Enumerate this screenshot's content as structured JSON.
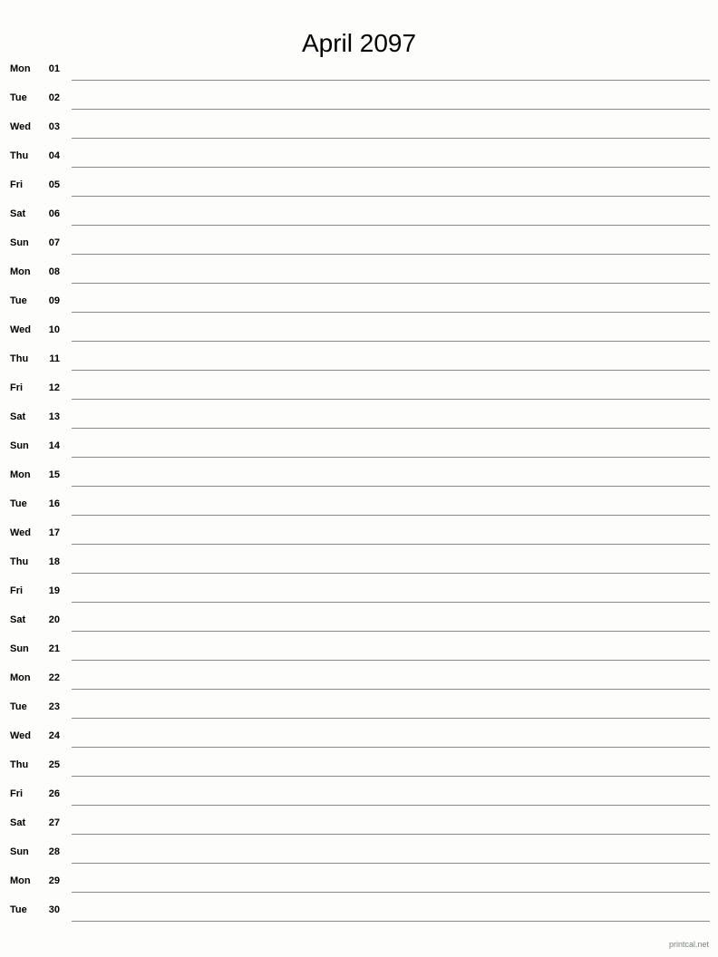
{
  "document": {
    "title": "April 2097",
    "type": "monthly-notes-calendar",
    "month": "April",
    "year": "2097"
  },
  "footer": {
    "credit": "printcal.net"
  },
  "colors": {
    "background": "#fdfefb",
    "text": "#000000",
    "rule_line": "#848a82",
    "footer_text": "#7d827c"
  },
  "days": [
    {
      "abbr": "Mon",
      "num": "01"
    },
    {
      "abbr": "Tue",
      "num": "02"
    },
    {
      "abbr": "Wed",
      "num": "03"
    },
    {
      "abbr": "Thu",
      "num": "04"
    },
    {
      "abbr": "Fri",
      "num": "05"
    },
    {
      "abbr": "Sat",
      "num": "06"
    },
    {
      "abbr": "Sun",
      "num": "07"
    },
    {
      "abbr": "Mon",
      "num": "08"
    },
    {
      "abbr": "Tue",
      "num": "09"
    },
    {
      "abbr": "Wed",
      "num": "10"
    },
    {
      "abbr": "Thu",
      "num": "11"
    },
    {
      "abbr": "Fri",
      "num": "12"
    },
    {
      "abbr": "Sat",
      "num": "13"
    },
    {
      "abbr": "Sun",
      "num": "14"
    },
    {
      "abbr": "Mon",
      "num": "15"
    },
    {
      "abbr": "Tue",
      "num": "16"
    },
    {
      "abbr": "Wed",
      "num": "17"
    },
    {
      "abbr": "Thu",
      "num": "18"
    },
    {
      "abbr": "Fri",
      "num": "19"
    },
    {
      "abbr": "Sat",
      "num": "20"
    },
    {
      "abbr": "Sun",
      "num": "21"
    },
    {
      "abbr": "Mon",
      "num": "22"
    },
    {
      "abbr": "Tue",
      "num": "23"
    },
    {
      "abbr": "Wed",
      "num": "24"
    },
    {
      "abbr": "Thu",
      "num": "25"
    },
    {
      "abbr": "Fri",
      "num": "26"
    },
    {
      "abbr": "Sat",
      "num": "27"
    },
    {
      "abbr": "Sun",
      "num": "28"
    },
    {
      "abbr": "Mon",
      "num": "29"
    },
    {
      "abbr": "Tue",
      "num": "30"
    }
  ]
}
